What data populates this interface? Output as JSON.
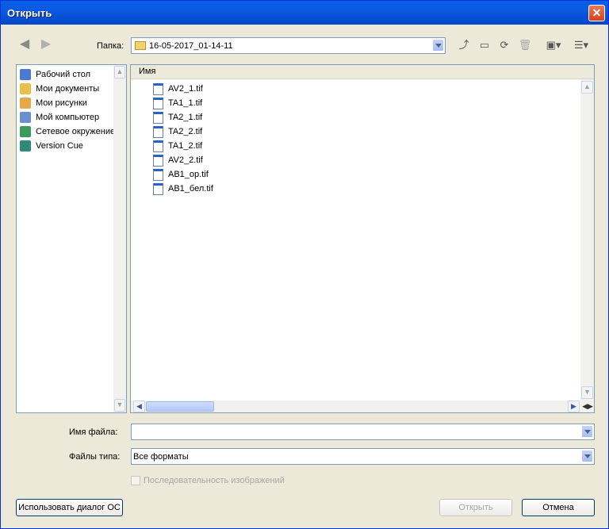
{
  "window": {
    "title": "Открыть"
  },
  "toolbar": {
    "folder_label": "Папка:",
    "folder_value": "16-05-2017_01-14-11",
    "icons": [
      "up-folder-icon",
      "new-folder-icon",
      "refresh-icon",
      "delete-icon",
      "tools-icon",
      "view-menu-icon"
    ]
  },
  "places": [
    {
      "label": "Рабочий стол",
      "icon": "desktop-icon",
      "color": "#4a7bd4"
    },
    {
      "label": "Мои документы",
      "icon": "my-documents-icon",
      "color": "#e8c04a"
    },
    {
      "label": "Мои рисунки",
      "icon": "my-pictures-icon",
      "color": "#e8a84a"
    },
    {
      "label": "Мой компьютер",
      "icon": "my-computer-icon",
      "color": "#6a8fd0"
    },
    {
      "label": "Сетевое окружение",
      "icon": "network-icon",
      "color": "#3c9a5a"
    },
    {
      "label": "Version Cue",
      "icon": "version-cue-icon",
      "color": "#2f8a7a"
    }
  ],
  "filelist": {
    "header": "Имя",
    "files": [
      "AV2_1.tif",
      "TA1_1.tif",
      "TA2_1.tif",
      "TA2_2.tif",
      "TA1_2.tif",
      "AV2_2.tif",
      "AB1_op.tif",
      "AB1_бел.tif"
    ]
  },
  "form": {
    "filename_label": "Имя файла:",
    "filename_value": "",
    "filetype_label": "Файлы типа:",
    "filetype_value": "Все форматы",
    "sequence_label": "Последовательность изображений"
  },
  "buttons": {
    "os_dialog": "Использовать диалог ОС",
    "open": "Открыть",
    "cancel": "Отмена"
  }
}
